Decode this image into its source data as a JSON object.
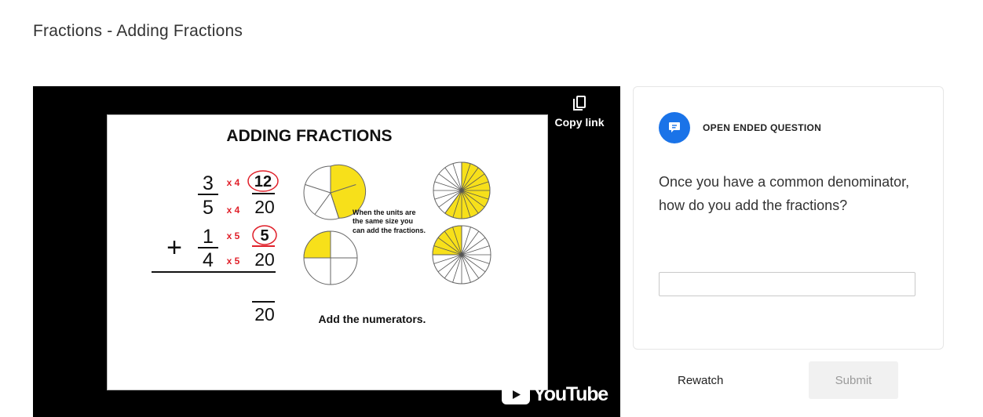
{
  "page": {
    "title": "Fractions - Adding Fractions"
  },
  "video": {
    "copy_link": "Copy link",
    "youtube": "YouTube",
    "slide": {
      "title": "ADDING FRACTIONS",
      "frac1": {
        "num": "3",
        "den": "5",
        "mult_num": "x 4",
        "mult_den": "x 4",
        "new_num": "12",
        "new_den": "20"
      },
      "frac2": {
        "num": "1",
        "den": "4",
        "mult_num": "x 5",
        "mult_den": "x 5",
        "new_num": "5",
        "new_den": "20"
      },
      "plus": "+",
      "result_den": "20",
      "note_lines": [
        "When the units are",
        "the same size you",
        "can add the fractions."
      ],
      "caption": "Add the numerators.",
      "colors": {
        "fill": "#f7e01a",
        "multiplier": "#e0202a"
      }
    }
  },
  "question": {
    "type_label": "OPEN ENDED QUESTION",
    "icon": "comment-icon",
    "text": "Once you have a common denominator, how do you add the fractions?",
    "answer_value": ""
  },
  "actions": {
    "rewatch": "Rewatch",
    "submit": "Submit"
  },
  "theme": {
    "accent": "#1a73e8",
    "submit_bg": "#f1f1f1",
    "submit_text": "#9a9a9a"
  }
}
